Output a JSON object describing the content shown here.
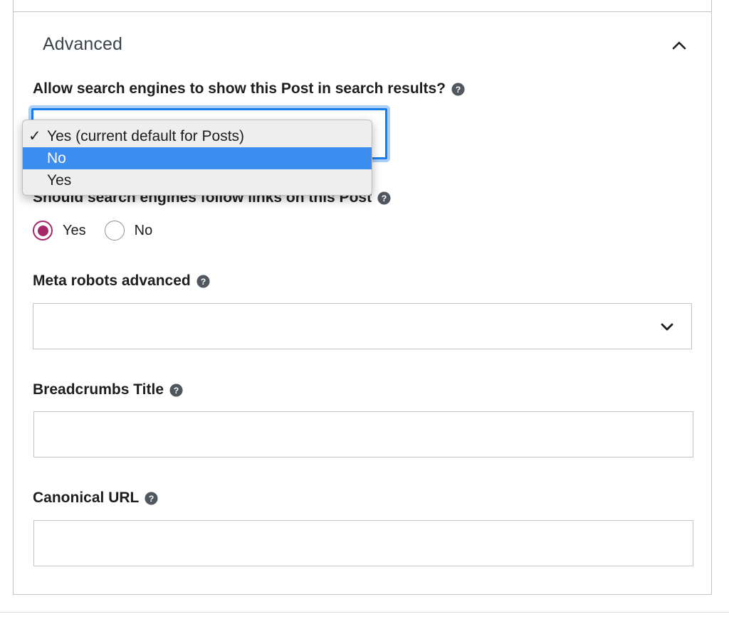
{
  "section": {
    "title": "Advanced",
    "toggle_icon": "chevron-up-icon"
  },
  "search_visibility": {
    "label": "Allow search engines to show this Post in search results?",
    "help_icon": "question-circle-icon",
    "selected_value": "Yes (current default for Posts)",
    "options": [
      {
        "label": "Yes (current default for Posts)",
        "checked": true,
        "highlighted": false
      },
      {
        "label": "No",
        "checked": false,
        "highlighted": true
      },
      {
        "label": "Yes",
        "checked": false,
        "highlighted": false
      }
    ],
    "check_glyph": "✓"
  },
  "follow_links": {
    "label": "Should search engines follow links on this Post",
    "help_icon": "question-circle-icon",
    "options": [
      {
        "label": "Yes",
        "checked": true
      },
      {
        "label": "No",
        "checked": false
      }
    ]
  },
  "meta_robots": {
    "label": "Meta robots advanced",
    "help_icon": "question-circle-icon",
    "value": "",
    "dropdown_icon": "chevron-down-icon"
  },
  "breadcrumbs_title": {
    "label": "Breadcrumbs Title",
    "help_icon": "question-circle-icon",
    "value": "",
    "placeholder": ""
  },
  "canonical_url": {
    "label": "Canonical URL",
    "help_icon": "question-circle-icon",
    "value": "",
    "placeholder": ""
  },
  "colors": {
    "focus_blue": "#1a7ce8",
    "highlight_blue": "#3b8df0",
    "radio_accent": "#a4286a",
    "border_gray": "#c3c4c7"
  }
}
